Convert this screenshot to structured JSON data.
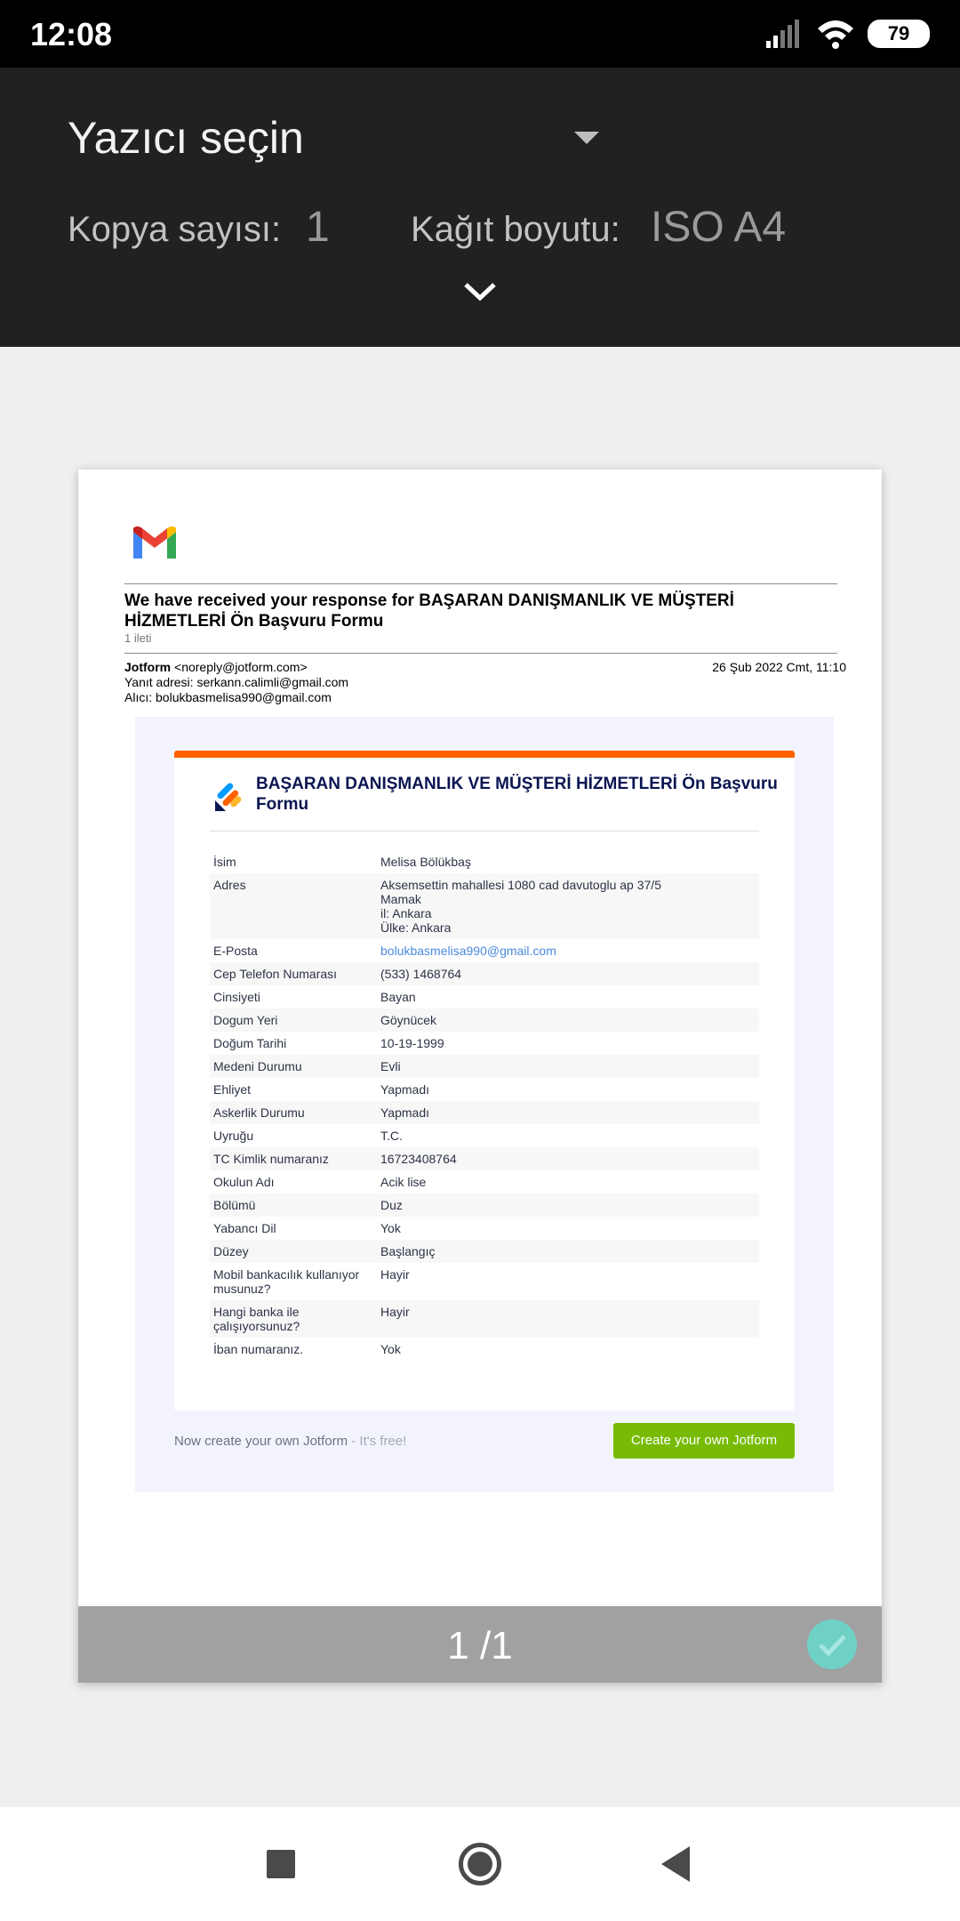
{
  "status_bar": {
    "time": "12:08",
    "battery": "79"
  },
  "print_header": {
    "printer_select": "Yazıcı seçin",
    "copies_label": "Kopya sayısı:",
    "copies_value": "1",
    "paper_label": "Kağıt boyutu:",
    "paper_value": "ISO A4"
  },
  "email": {
    "subject": "We have received your response for BAŞARAN DANIŞMANLIK VE MÜŞTERİ HİZMETLERİ Ön Başvuru Formu",
    "message_count": "1 ileti",
    "sender_name": "Jotform",
    "sender_email": "<noreply@jotform.com>",
    "reply_to": "Yanıt adresi: serkann.calimli@gmail.com",
    "recipient": "Alıcı: bolukbasmelisa990@gmail.com",
    "date": "26 Şub 2022 Cmt, 11:10"
  },
  "form": {
    "title": "BAŞARAN DANIŞMANLIK VE MÜŞTERİ HİZMETLERİ Ön Başvuru Formu",
    "rows": [
      {
        "label": "İsim",
        "value": "Melisa Bölükbaş"
      },
      {
        "label": "Adres",
        "value_lines": [
          "Aksemsettin mahallesi 1080 cad davutoglu ap 37/5",
          "Mamak",
          "il: Ankara",
          "Ülke: Ankara"
        ]
      },
      {
        "label": "E-Posta",
        "value": "bolukbasmelisa990@gmail.com"
      },
      {
        "label": "Cep Telefon Numarası",
        "value": "(533) 1468764"
      },
      {
        "label": "Cinsiyeti",
        "value": "Bayan"
      },
      {
        "label": "Dogum Yeri",
        "value": "Göynücek"
      },
      {
        "label": "Doğum Tarihi",
        "value": "10-19-1999"
      },
      {
        "label": "Medeni Durumu",
        "value": "Evli"
      },
      {
        "label": "Ehliyet",
        "value": "Yapmadı"
      },
      {
        "label": "Askerlik Durumu",
        "value": "Yapmadı"
      },
      {
        "label": "Uyruğu",
        "value": "T.C."
      },
      {
        "label": "TC Kimlik numaranız",
        "value": "16723408764"
      },
      {
        "label": "Okulun Adı",
        "value": "Acik lise"
      },
      {
        "label": "Bölümü",
        "value": "Duz"
      },
      {
        "label": "Yabancı Dil",
        "value": "Yok"
      },
      {
        "label": "Düzey",
        "value": "Başlangıç"
      },
      {
        "label": "Mobil bankacılık kullanıyor musunuz?",
        "value": "Hayir"
      },
      {
        "label": "Hangi banka ile çalışıyorsunuz?",
        "value": "Hayir"
      },
      {
        "label": "İban numaranız.",
        "value": "Yok"
      }
    ],
    "footer_text": "Now create your own Jotform",
    "footer_free": " - It's free!",
    "create_button": "Create your own Jotform"
  },
  "preview": {
    "page_count": "1 /1"
  },
  "colors": {
    "jotform_orange": "#ff6100",
    "jotform_green": "#78bb07",
    "form_title": "#0a1551",
    "check_teal": "#6fd0c6"
  }
}
